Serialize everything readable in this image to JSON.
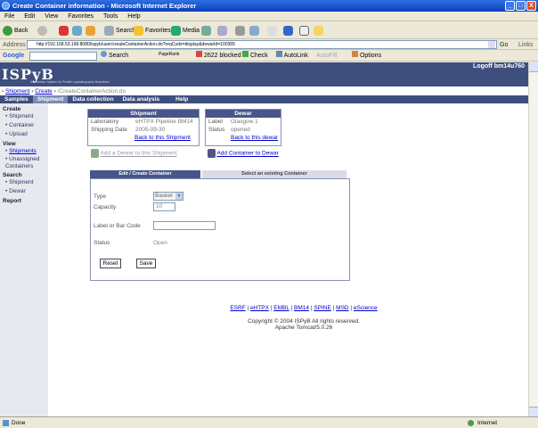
{
  "window": {
    "title": "Create Container information - Microsoft Internet Explorer",
    "controls": {
      "minimize": "_",
      "maximize": "□",
      "close": "X"
    }
  },
  "menu": {
    "items": [
      "File",
      "Edit",
      "View",
      "Favorites",
      "Tools",
      "Help"
    ]
  },
  "toolbar": {
    "back": "Back",
    "search": "Search",
    "favorites": "Favorites",
    "media": "Media"
  },
  "address": {
    "label": "Address",
    "url": "http://192.168.53.196:8080/ispyb/user/createContainerAction.do?reqCode=display&dewarId=100365",
    "go": "Go",
    "links": "Links"
  },
  "google": {
    "brand": "Google",
    "search": "Search",
    "pagerank": "PageRank",
    "blocked": "2622 blocked",
    "check": "Check",
    "autolink": "AutoLink",
    "autofill": "AutoFill",
    "options": "Options"
  },
  "site": {
    "logo": "ISPyB",
    "logo_sub": "Information System for Protein crystallography Beamlines",
    "logoff": "Logoff bm14u760"
  },
  "breadcrumb": {
    "items": [
      "Shipment",
      "Create",
      "/CreateContainerAction.do"
    ]
  },
  "tabs": [
    "Samples",
    "Shipment",
    "Data collection",
    "Data analysis",
    "Help"
  ],
  "sidebar": {
    "create": {
      "title": "Create",
      "items": [
        "Shipment",
        "Container",
        "Upload"
      ]
    },
    "view": {
      "title": "View",
      "items": [
        "Shipments",
        "Unassigned Containers"
      ]
    },
    "search": {
      "title": "Search",
      "items": [
        "Shipment",
        "Dewar"
      ]
    },
    "report": {
      "title": "Report"
    }
  },
  "shipment_box": {
    "title": "Shipment",
    "lab_label": "Laboratory",
    "lab_value": "eHTPX Pipeline BM14",
    "date_label": "Shipping Date",
    "date_value": "2005-09-30",
    "back_link": "Back to this Shipment"
  },
  "dewar_box": {
    "title": "Dewar",
    "label_label": "Label",
    "label_value": "Glasgow 1",
    "status_label": "Status",
    "status_value": "opened",
    "back_link": "Back to this dewar"
  },
  "actions": {
    "add_dewar": "Add a Dewar to this Shipment",
    "add_container": "Add Container to Dewar"
  },
  "form": {
    "tab_edit": "Edit / Create Container",
    "tab_select": "Select an existing Container",
    "type_label": "Type",
    "type_value": "Basket",
    "capacity_label": "Capacity",
    "capacity_value": "10",
    "barcode_label": "Label or Bar Code",
    "barcode_value": "",
    "status_label": "Status",
    "status_value": "Open",
    "reset": "Reset",
    "save": "Save"
  },
  "footer": {
    "links": [
      "ESRF",
      "eHTPX",
      "EMBL",
      "BM14",
      "SPINE",
      "MSD",
      "eScience"
    ],
    "copyright": "Copyright © 2004 ISPyB All rights reserved.",
    "server": "Apache Tomcat/5.0.26"
  },
  "status": {
    "left": "Done",
    "zone": "Internet"
  }
}
